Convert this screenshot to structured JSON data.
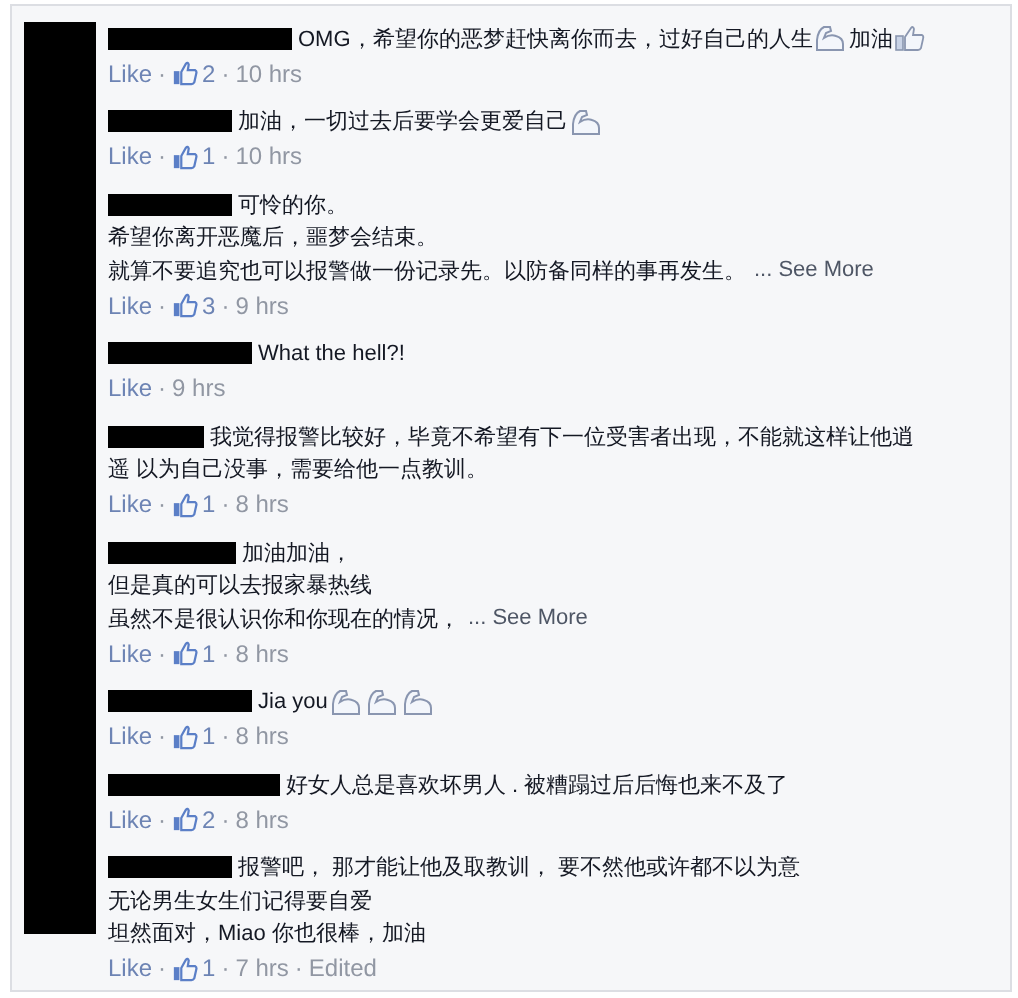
{
  "separator": "·",
  "comments": [
    {
      "lines": [
        [
          {
            "kind": "text",
            "text": "OMG，希望你的恶梦赶快离你而去，过好自己的人生"
          },
          {
            "kind": "flex-emoji"
          },
          {
            "kind": "text",
            "text": "加油"
          },
          {
            "kind": "thumb-emoji"
          }
        ]
      ],
      "action": "Like",
      "likes": "2",
      "time": "10 hrs"
    },
    {
      "lines": [
        [
          {
            "kind": "text",
            "text": "加油，一切过去后要学会更爱自己"
          },
          {
            "kind": "flex-emoji"
          }
        ]
      ],
      "action": "Like",
      "likes": "1",
      "time": "10 hrs"
    },
    {
      "lines": [
        [
          {
            "kind": "text",
            "text": "可怜的你。"
          }
        ],
        [
          {
            "kind": "text",
            "text": "希望你离开恶魔后，噩梦会结束。"
          }
        ],
        [
          {
            "kind": "text",
            "text": "就算不要追究也可以报警做一份记录先。以防备同样的事再发生。"
          }
        ]
      ],
      "see_more": "... See More",
      "action": "Like",
      "likes": "3",
      "time": "9 hrs"
    },
    {
      "lines": [
        [
          {
            "kind": "text",
            "text": "What the hell?!"
          }
        ]
      ],
      "action": "Like",
      "time": "9 hrs"
    },
    {
      "lines": [
        [
          {
            "kind": "text",
            "text": "我觉得报警比较好，毕竟不希望有下一位受害者出现，不能就这样让他逍"
          }
        ],
        [
          {
            "kind": "text",
            "text": "遥 以为自己没事，需要给他一点教训。"
          }
        ]
      ],
      "action": "Like",
      "likes": "1",
      "time": "8 hrs"
    },
    {
      "lines": [
        [
          {
            "kind": "text",
            "text": "加油加油，"
          }
        ],
        [
          {
            "kind": "text",
            "text": "但是真的可以去报家暴热线"
          }
        ],
        [
          {
            "kind": "text",
            "text": "虽然不是很认识你和你现在的情况，"
          }
        ]
      ],
      "see_more": "... See More",
      "action": "Like",
      "likes": "1",
      "time": "8 hrs"
    },
    {
      "lines": [
        [
          {
            "kind": "text",
            "text": "Jia you"
          },
          {
            "kind": "flex-emoji"
          },
          {
            "kind": "flex-emoji"
          },
          {
            "kind": "flex-emoji"
          }
        ]
      ],
      "action": "Like",
      "likes": "1",
      "time": "8 hrs"
    },
    {
      "lines": [
        [
          {
            "kind": "text",
            "text": "好女人总是喜欢坏男人 . 被糟蹋过后后悔也来不及了"
          }
        ]
      ],
      "action": "Like",
      "likes": "2",
      "time": "8 hrs"
    },
    {
      "lines": [
        [
          {
            "kind": "text",
            "text": "报警吧， 那才能让他及取教训， 要不然他或许都不以为意"
          }
        ],
        [
          {
            "kind": "text",
            "text": "无论男生女生们记得要自爱"
          }
        ],
        [
          {
            "kind": "text",
            "text": "坦然面对，Miao 你也很棒，加油"
          }
        ]
      ],
      "action": "Like",
      "likes": "1",
      "time": "7 hrs",
      "edited": "Edited"
    }
  ]
}
